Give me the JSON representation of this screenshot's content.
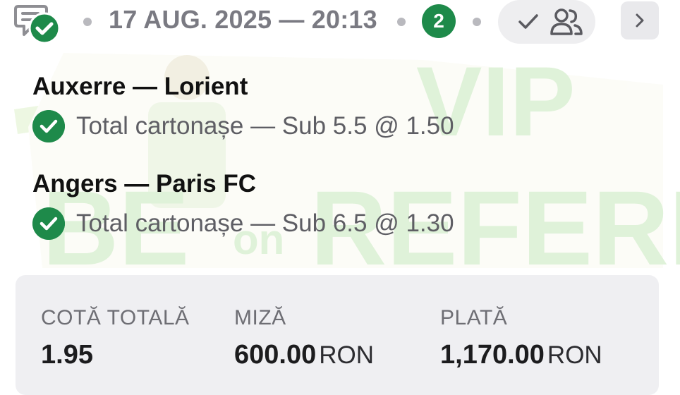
{
  "header": {
    "datetime": "17 AUG. 2025 — 20:13",
    "count": "2"
  },
  "watermark": {
    "line1": "VIP",
    "line2_left": "BE",
    "line2_mid": "on",
    "line2_right": "REFEREE"
  },
  "selections": [
    {
      "match": "Auxerre — Lorient",
      "bet": "Total cartonașe — Sub 5.5 @ 1.50"
    },
    {
      "match": "Angers — Paris FC",
      "bet": "Total cartonașe — Sub 6.5 @ 1.30"
    }
  ],
  "summary": {
    "total_odds_label": "COTĂ TOTALĂ",
    "total_odds_value": "1.95",
    "stake_label": "MIZĂ",
    "stake_value": "600.00",
    "stake_currency": "RON",
    "payout_label": "PLATĂ",
    "payout_value": "1,170.00",
    "payout_currency": "RON"
  },
  "colors": {
    "accent_green": "#1e8a4a",
    "muted_text": "#7a7a82",
    "watermark_green": "#9fd88a",
    "watermark_yellow": "#f4e08a"
  },
  "icons": [
    "ticket-check-icon",
    "checkmark-icon",
    "people-icon",
    "chevron-right-icon",
    "check-circle-icon"
  ]
}
